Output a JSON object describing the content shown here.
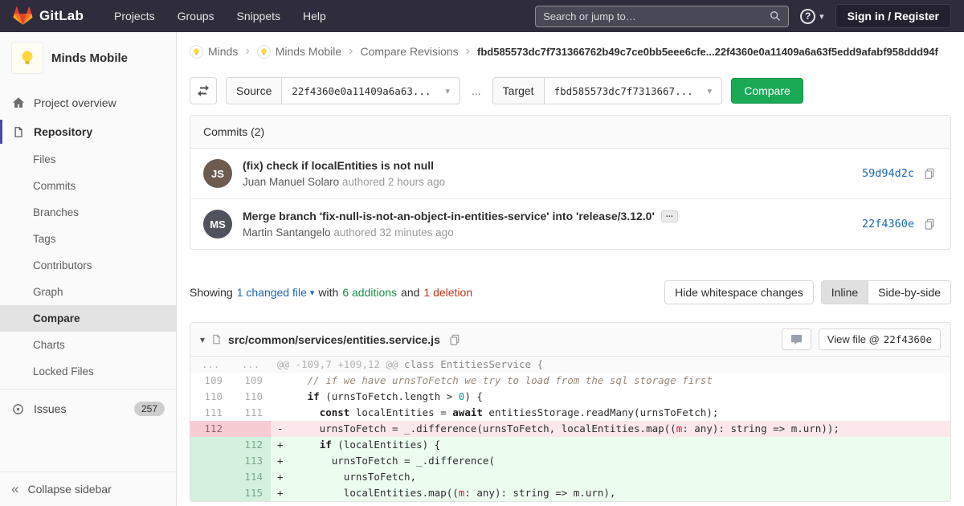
{
  "icons": {
    "caret_down": "▾",
    "breadcrumb_separator": "›",
    "help_glyph": "?",
    "collapse_glyph": "«"
  },
  "navbar": {
    "brand": "GitLab",
    "links": [
      "Projects",
      "Groups",
      "Snippets",
      "Help"
    ],
    "search_placeholder": "Search or jump to…",
    "sign_in_label": "Sign in / Register"
  },
  "sidebar": {
    "project_name": "Minds Mobile",
    "project_overview": "Project overview",
    "repository": "Repository",
    "repo_subitems": [
      "Files",
      "Commits",
      "Branches",
      "Tags",
      "Contributors",
      "Graph",
      "Compare",
      "Charts",
      "Locked Files"
    ],
    "active_subitem": "Compare",
    "issues_label": "Issues",
    "issues_count": "257",
    "collapse_label": "Collapse sidebar"
  },
  "breadcrumb": {
    "group": "Minds",
    "project": "Minds Mobile",
    "page": "Compare Revisions",
    "compare_range": "fbd585573dc7f731366762b49c7ce0bb5eee6cfe...22f4360e0a11409a6a63f5edd9afabf958ddd94f"
  },
  "compare_form": {
    "source_label": "Source",
    "source_value": "22f4360e0a11409a6a63...",
    "separator": "...",
    "target_label": "Target",
    "target_value": "fbd585573dc7f7313667...",
    "compare_button": "Compare"
  },
  "commits": {
    "header": "Commits (2)",
    "expander_label": "...",
    "items": [
      {
        "title": "(fix) check if localEntities is not null",
        "author": "Juan Manuel Solaro",
        "authored": "authored 2 hours ago",
        "sha": "59d94d2c",
        "initials": "JS",
        "avatar_color": "#6d5b50",
        "expander": false
      },
      {
        "title": "Merge branch 'fix-null-is-not-an-object-in-entities-service' into 'release/3.12.0'",
        "author": "Martin Santangelo",
        "authored": "authored 32 minutes ago",
        "sha": "22f4360e",
        "initials": "MS",
        "avatar_color": "#50535e",
        "expander": true
      }
    ]
  },
  "diff_summary": {
    "showing": "Showing",
    "changed_files": "1 changed file",
    "with_text": "with",
    "additions": "6 additions",
    "and_text": "and",
    "deletions": "1 deletion",
    "hide_whitespace": "Hide whitespace changes",
    "inline": "Inline",
    "side_by_side": "Side-by-side"
  },
  "diff_file": {
    "path": "src/common/services/entities.service.js",
    "view_file_label": "View file @",
    "view_file_sha": "22f4360e",
    "lines": [
      {
        "type": "hunk",
        "old": "...",
        "new": "...",
        "segments": [
          {
            "t": "@@ -109,7 +109,12 @@ ",
            "c": "hunk-range"
          },
          {
            "t": "class EntitiesService {",
            "c": "hunk-section"
          }
        ]
      },
      {
        "type": "context",
        "old": "109",
        "new": "109",
        "sign": " ",
        "segments": [
          {
            "t": "    ",
            "c": ""
          },
          {
            "t": "// if we have urnsToFetch we try to load from the sql storage first",
            "c": "cm"
          }
        ]
      },
      {
        "type": "context",
        "old": "110",
        "new": "110",
        "sign": " ",
        "segments": [
          {
            "t": "    ",
            "c": ""
          },
          {
            "t": "if",
            "c": "kw"
          },
          {
            "t": " (urnsToFetch.length > ",
            "c": ""
          },
          {
            "t": "0",
            "c": "num"
          },
          {
            "t": ") {",
            "c": ""
          }
        ]
      },
      {
        "type": "context",
        "old": "111",
        "new": "111",
        "sign": " ",
        "segments": [
          {
            "t": "      ",
            "c": ""
          },
          {
            "t": "const",
            "c": "kw"
          },
          {
            "t": " localEntities = ",
            "c": ""
          },
          {
            "t": "await",
            "c": "kw"
          },
          {
            "t": " entitiesStorage.readMany(urnsToFetch);",
            "c": ""
          }
        ]
      },
      {
        "type": "del",
        "old": "112",
        "new": "",
        "sign": "-",
        "segments": [
          {
            "t": "      urnsToFetch = _.difference(urnsToFetch, localEntities.map((",
            "c": ""
          },
          {
            "t": "m",
            "c": "var"
          },
          {
            "t": ": any): string => m.urn));",
            "c": ""
          }
        ]
      },
      {
        "type": "add",
        "old": "",
        "new": "112",
        "sign": "+",
        "segments": [
          {
            "t": "      ",
            "c": ""
          },
          {
            "t": "if",
            "c": "kw"
          },
          {
            "t": " (localEntities) {",
            "c": ""
          }
        ]
      },
      {
        "type": "add",
        "old": "",
        "new": "113",
        "sign": "+",
        "segments": [
          {
            "t": "        urnsToFetch = _.difference(",
            "c": ""
          }
        ]
      },
      {
        "type": "add",
        "old": "",
        "new": "114",
        "sign": "+",
        "segments": [
          {
            "t": "          urnsToFetch,",
            "c": ""
          }
        ]
      },
      {
        "type": "add",
        "old": "",
        "new": "115",
        "sign": "+",
        "segments": [
          {
            "t": "          localEntities.map((",
            "c": ""
          },
          {
            "t": "m",
            "c": "var"
          },
          {
            "t": ": any): string => m.urn),",
            "c": ""
          }
        ]
      }
    ]
  }
}
